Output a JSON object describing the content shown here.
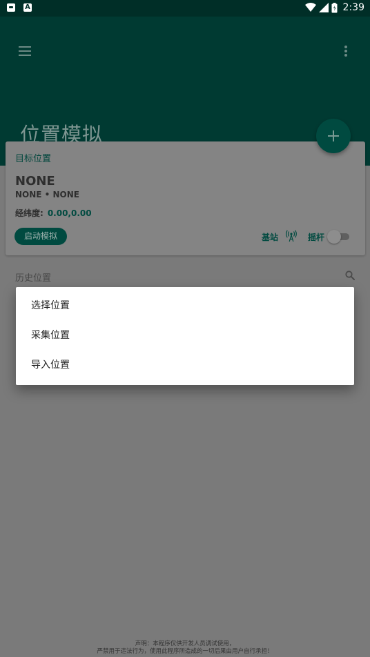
{
  "status_bar": {
    "time": "2:39",
    "left_icons": [
      "android-app-icon",
      "a-app-icon"
    ],
    "right_icons": [
      "wifi-icon",
      "signal-icon",
      "battery-icon"
    ]
  },
  "app_bar": {
    "title": "位置模拟"
  },
  "target": {
    "label": "目标位置",
    "name": "NONE",
    "subtitle": "NONE • NONE",
    "coord_label": "经纬度:",
    "coord_value": "0.00,0.00",
    "start_button": "启动模拟",
    "base_station_label": "基站",
    "joystick_label": "摇杆",
    "joystick_on": false
  },
  "history": {
    "label": "历史位置"
  },
  "menu_dialog": {
    "items": [
      {
        "label": "选择位置"
      },
      {
        "label": "采集位置"
      },
      {
        "label": "导入位置"
      }
    ]
  },
  "disclaimer": {
    "line1": "声明：本程序仅供开发人员调试使用，",
    "line2": "严禁用于违法行为，使用此程序所造成的一切后果由用户自行承担！"
  },
  "colors": {
    "primary": "#00695c",
    "scrim": "rgba(0,0,0,0.5)"
  }
}
